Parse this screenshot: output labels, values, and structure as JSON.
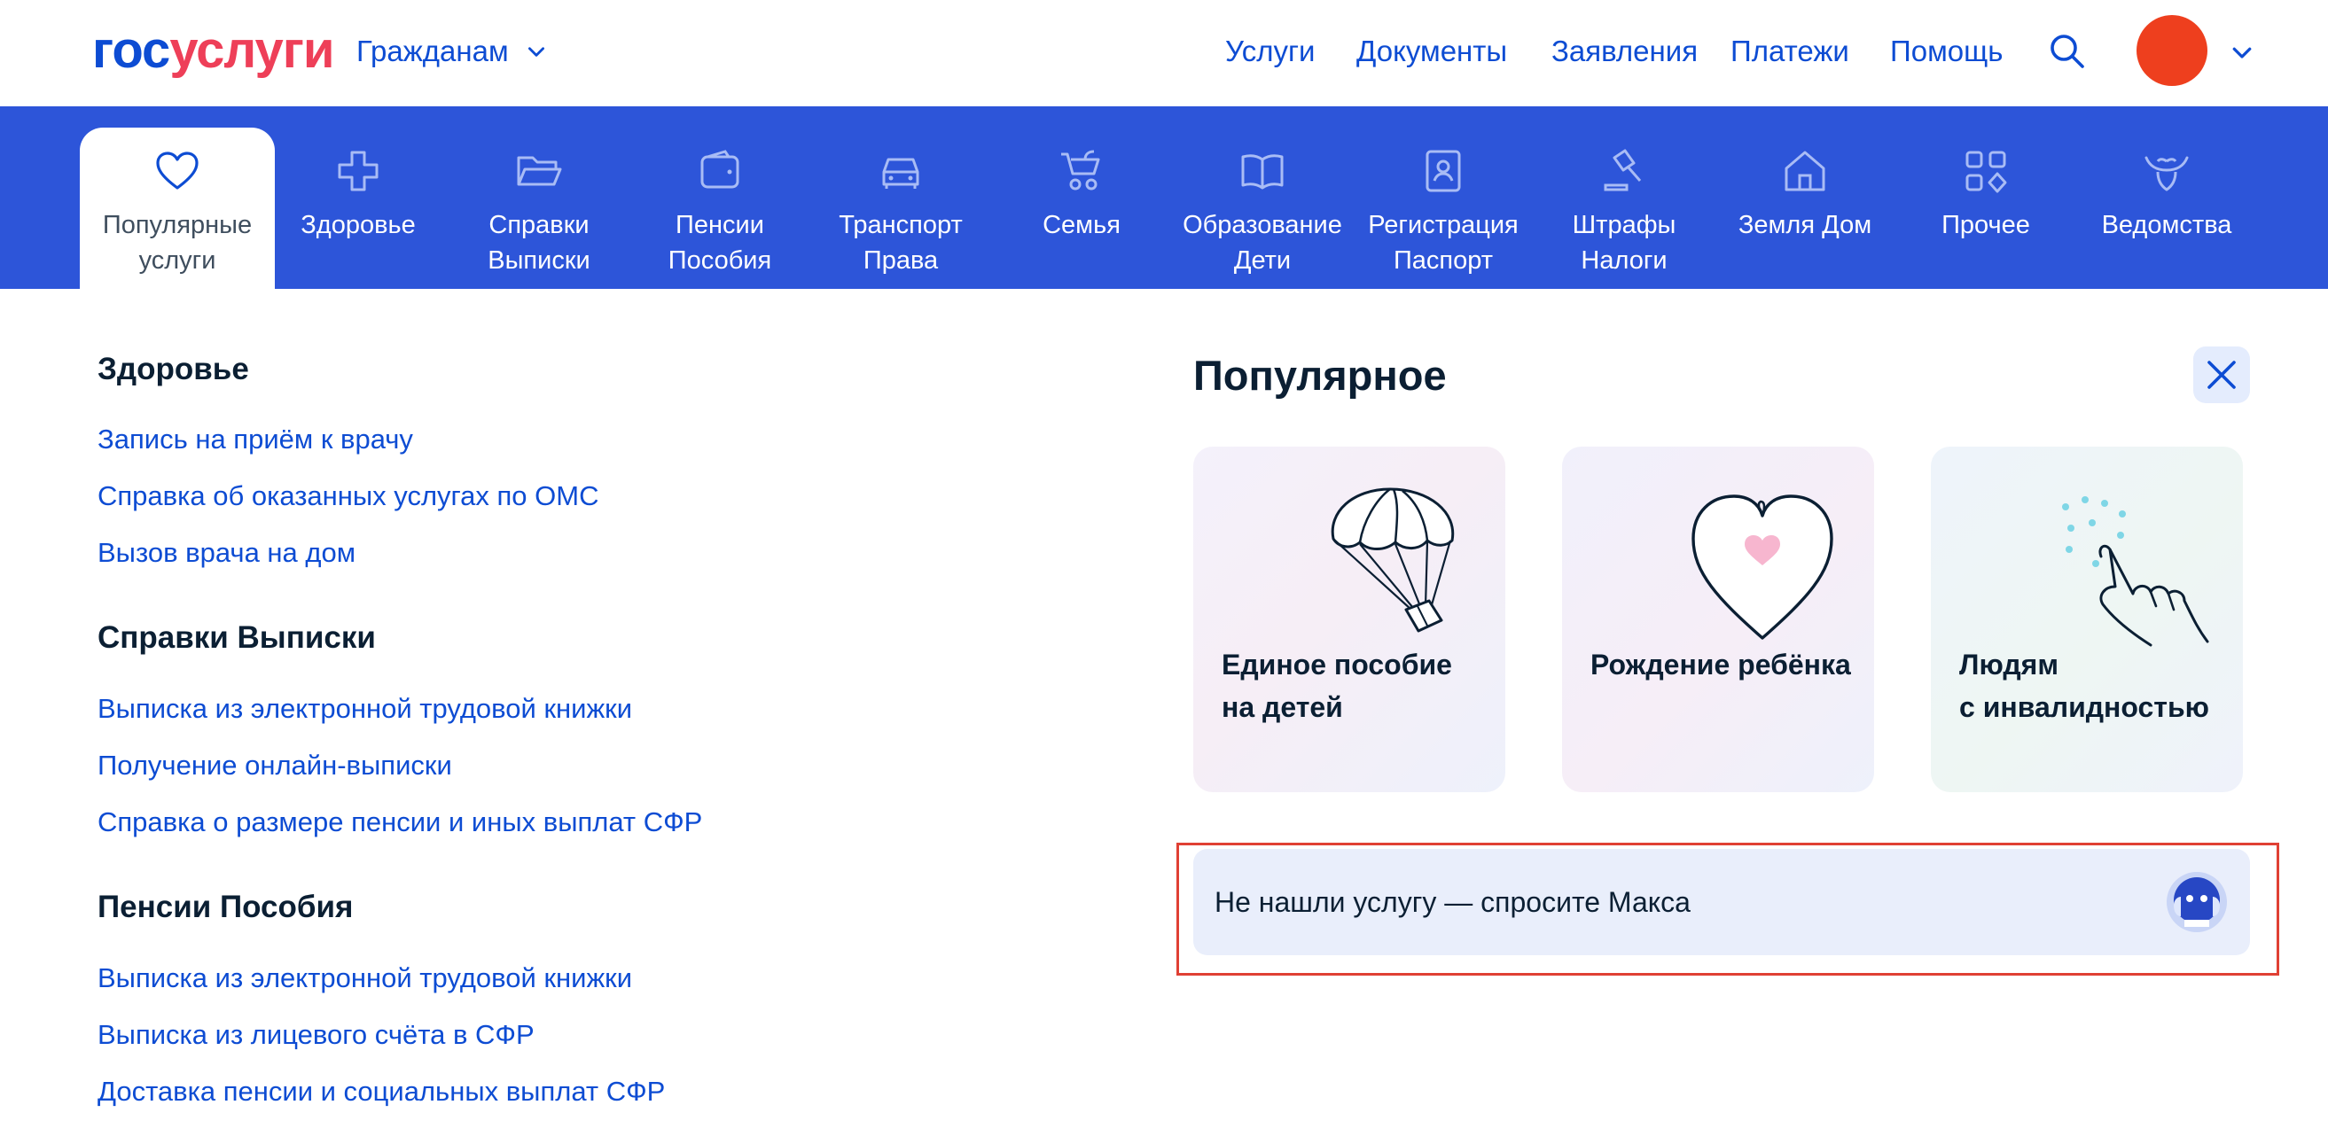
{
  "header": {
    "logo_part1": "гос",
    "logo_part2": "услуги",
    "role_label": "Гражданам",
    "nav": [
      "Услуги",
      "Документы",
      "Заявления",
      "Платежи",
      "Помощь"
    ],
    "accent_color": "#0d4cd3",
    "avatar_color": "#ee3f1e"
  },
  "categories": [
    {
      "label": "Популярные\nуслуги",
      "icon": "heart-icon",
      "active": true
    },
    {
      "label": "Здоровье",
      "icon": "medical-cross-icon"
    },
    {
      "label": "Справки\nВыписки",
      "icon": "folder-icon"
    },
    {
      "label": "Пенсии\nПособия",
      "icon": "wallet-icon"
    },
    {
      "label": "Транспорт\nПрава",
      "icon": "car-icon"
    },
    {
      "label": "Семья",
      "icon": "stroller-icon"
    },
    {
      "label": "Образование\nДети",
      "icon": "book-icon"
    },
    {
      "label": "Регистрация\nПаспорт",
      "icon": "id-card-icon"
    },
    {
      "label": "Штрафы\nНалоги",
      "icon": "gavel-icon"
    },
    {
      "label": "Земля Дом",
      "icon": "house-icon"
    },
    {
      "label": "Прочее",
      "icon": "grid-icon"
    },
    {
      "label": "Ведомства",
      "icon": "eagle-icon"
    }
  ],
  "sections": [
    {
      "title": "Здоровье",
      "links": [
        "Запись на приём к врачу",
        "Справка об оказанных услугах по ОМС",
        "Вызов врача на дом"
      ]
    },
    {
      "title": "Справки Выписки",
      "links": [
        "Выписка из электронной трудовой книжки",
        "Получение онлайн-выписки",
        "Справка о размере пенсии и иных выплат СФР"
      ]
    },
    {
      "title": "Пенсии Пособия",
      "links": [
        "Выписка из электронной трудовой книжки",
        "Выписка из лицевого счёта в СФР",
        "Доставка пенсии и социальных выплат СФР"
      ]
    }
  ],
  "popular": {
    "title": "Популярное",
    "cards": [
      {
        "title": "Единое пособие\nна детей",
        "icon": "parachute-box-icon"
      },
      {
        "title": "Рождение ребёнка",
        "icon": "heart-outline-icon"
      },
      {
        "title": "Людям\nс инвалидностью",
        "icon": "hand-braille-icon"
      }
    ],
    "ask_text": "Не нашли услугу — спросите Макса",
    "ask_icon": "robot-max-icon"
  }
}
